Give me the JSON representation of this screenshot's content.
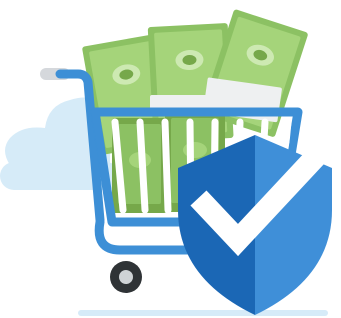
{
  "illustration": {
    "subject": "secure-shopping-cart",
    "icons": [
      "cloud-icon",
      "shopping-cart-icon",
      "money-stack-icon",
      "shield-check-icon"
    ],
    "colors": {
      "cloud": "#d6ebf8",
      "cart_frame": "#3d8fd6",
      "cart_basket_line": "#ffffff",
      "cart_handle_grip": "#d5d8dc",
      "wheel_outer": "#2f3336",
      "wheel_inner": "#cfd3d6",
      "money_light": "#a5d47a",
      "money_dark": "#76a84a",
      "money_medallion": "#cde9b2",
      "money_band": "#eef0f1",
      "shield_left": "#1b67b5",
      "shield_right": "#3f8fd8",
      "checkmark": "#ffffff",
      "ground_line": "#d6ebf8"
    }
  }
}
